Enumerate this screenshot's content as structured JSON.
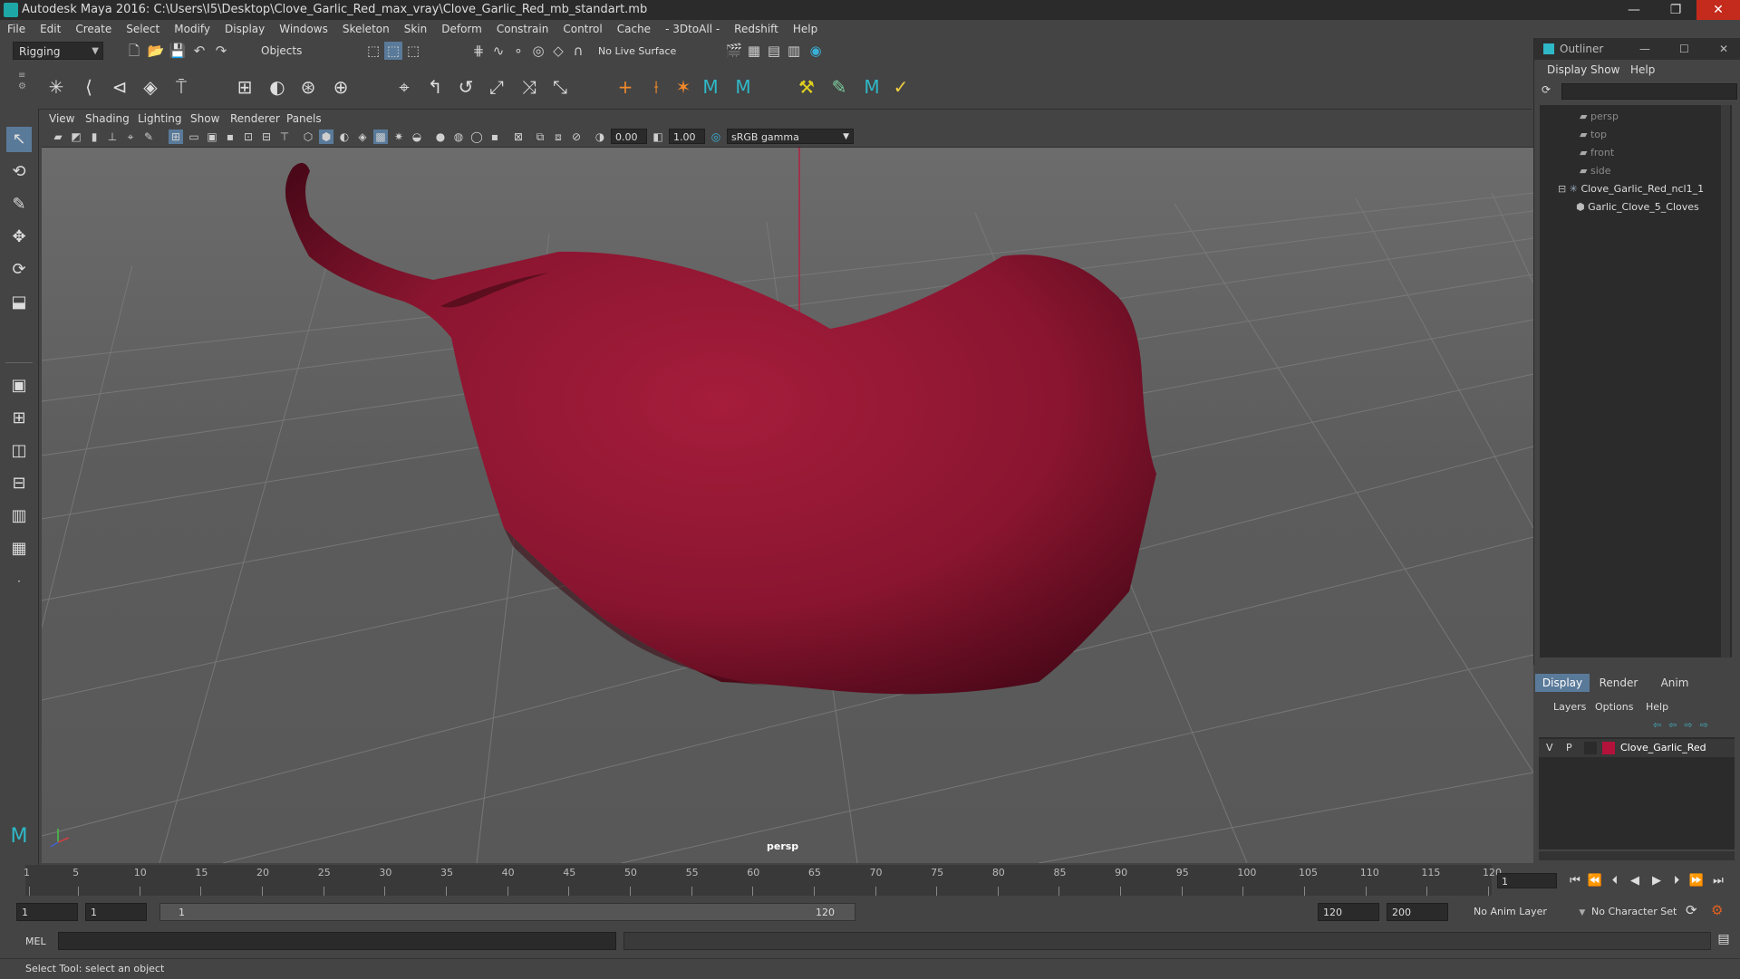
{
  "window": {
    "title": "Autodesk Maya 2016: C:\\Users\\I5\\Desktop\\Clove_Garlic_Red_max_vray\\Clove_Garlic_Red_mb_standart.mb",
    "minimize": "—",
    "restore": "❐",
    "close": "✕"
  },
  "menubar": [
    "File",
    "Edit",
    "Create",
    "Select",
    "Modify",
    "Display",
    "Windows",
    "Skeleton",
    "Skin",
    "Deform",
    "Constrain",
    "Control",
    "Cache",
    "- 3DtoAll -",
    "Redshift",
    "Help"
  ],
  "status_line": {
    "menuset": "Rigging",
    "selection_mode": "Objects",
    "live_surface": "No Live Surface"
  },
  "viewport": {
    "menu": [
      "View",
      "Shading",
      "Lighting",
      "Show",
      "Renderer",
      "Panels"
    ],
    "exposure": "0.00",
    "gamma": "1.00",
    "color_space": "sRGB gamma",
    "camera_label": "persp",
    "model_color": "#a11a35"
  },
  "timeline": {
    "ticks": [
      "1",
      "5",
      "10",
      "15",
      "20",
      "25",
      "30",
      "35",
      "40",
      "45",
      "50",
      "55",
      "60",
      "65",
      "70",
      "75",
      "80",
      "85",
      "90",
      "95",
      "100",
      "105",
      "110",
      "115",
      "120"
    ],
    "current_frame": "1"
  },
  "range": {
    "start": "1",
    "playback_start": "1",
    "slider_start": "1",
    "slider_end": "120",
    "playback_end": "120",
    "end": "200",
    "anim_layer": "No Anim Layer",
    "character_set": "No Character Set"
  },
  "command_line": {
    "label": "MEL"
  },
  "help_line": "Select Tool: select an object",
  "outliner": {
    "title": "Outliner",
    "menu": [
      "Display",
      "Show",
      "Help"
    ],
    "items": [
      {
        "label": "persp",
        "dim": true
      },
      {
        "label": "top",
        "dim": true
      },
      {
        "label": "front",
        "dim": true
      },
      {
        "label": "side",
        "dim": true
      },
      {
        "label": "Clove_Garlic_Red_ncl1_1",
        "dim": false
      },
      {
        "label": "Garlic_Clove_5_Cloves",
        "dim": false
      }
    ]
  },
  "layer_editor": {
    "tabs": [
      "Display",
      "Render",
      "Anim"
    ],
    "menu": [
      "Layers",
      "Options",
      "Help"
    ],
    "layer": {
      "v": "V",
      "p": "P",
      "name": "Clove_Garlic_Red",
      "color": "#b3123a"
    }
  }
}
